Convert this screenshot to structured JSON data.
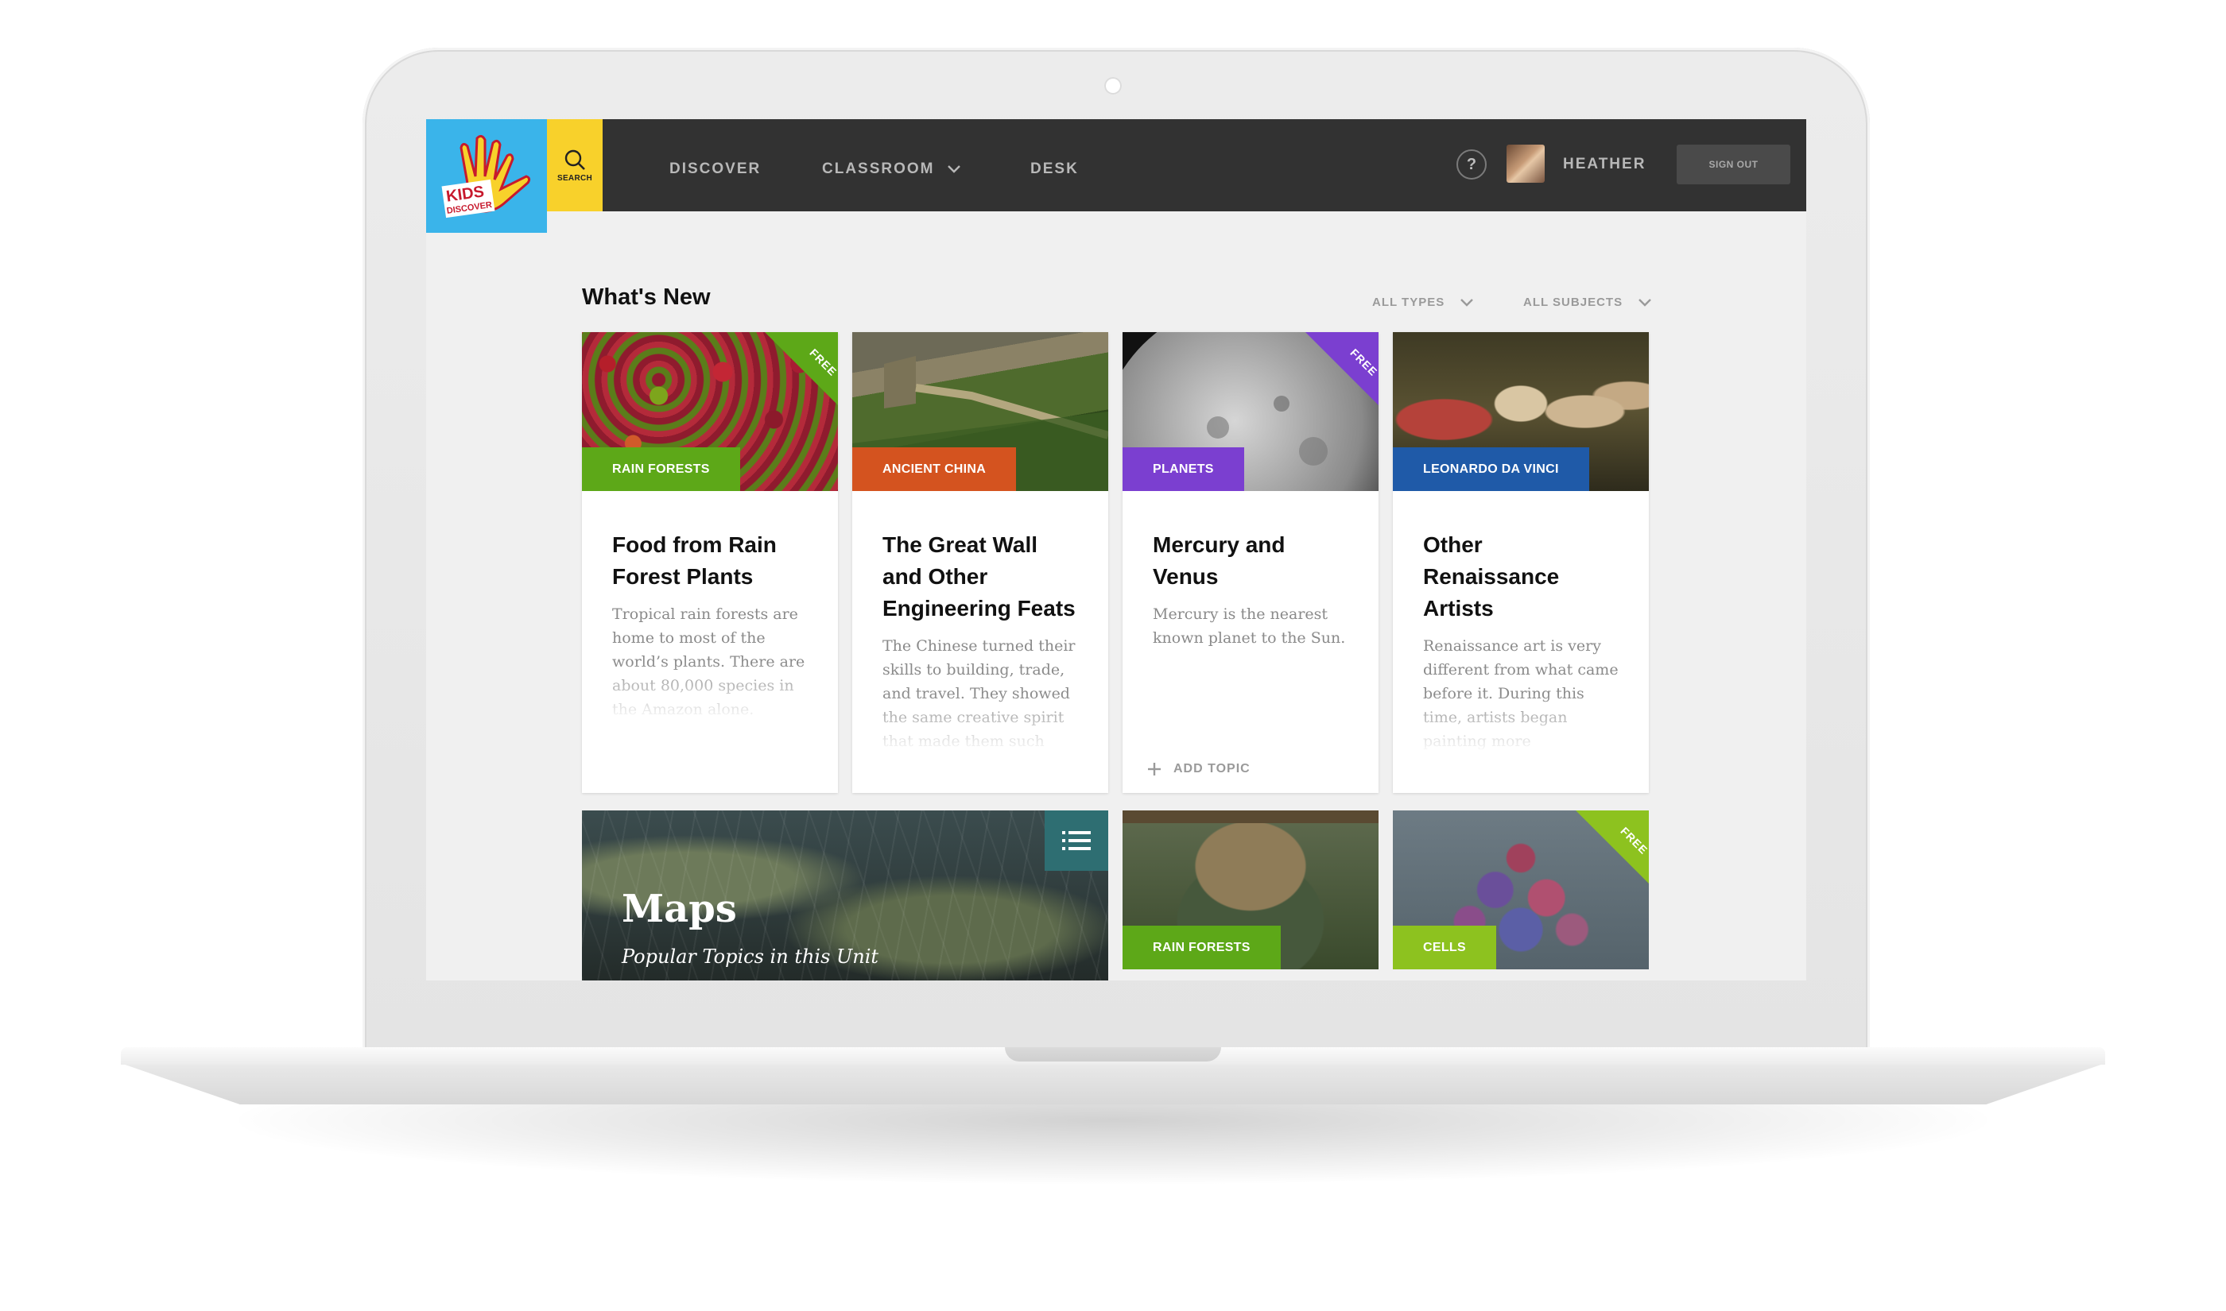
{
  "colors": {
    "topbar": "#323232",
    "logo_bg": "#3ab4ea",
    "search_bg": "#f8d12b",
    "tag_green": "#5da818",
    "tag_orange": "#d4531f",
    "tag_purple": "#7b3fd0",
    "tag_blue": "#1f5aa8",
    "tag_lime": "#8dc21f",
    "free_green": "#5da818",
    "free_purple": "#7b3fd0",
    "free_lime": "#8dc21f"
  },
  "logo": {
    "text": "KIDS DISCOVER"
  },
  "header": {
    "search_label": "SEARCH",
    "nav": [
      "DISCOVER",
      "CLASSROOM",
      "DESK"
    ],
    "help_label": "?",
    "user_name": "HEATHER",
    "signout_label": "SIGN OUT"
  },
  "main": {
    "section_title": "What's New",
    "filter_types": "ALL TYPES",
    "filter_subjects": "ALL SUBJECTS",
    "free_label": "FREE",
    "cards": [
      {
        "tag": "RAIN FORESTS",
        "title": "Food from Rain Forest Plants",
        "description": "Tropical rain forests are home to most of the world’s plants. There are about 80,000 species in the Amazon alone."
      },
      {
        "tag": "ANCIENT CHINA",
        "title": "The Great Wall and Other Engineering Feats",
        "description": "The Chinese turned their skills to building, trade, and travel. They showed the same creative spirit that made them such"
      },
      {
        "tag": "PLANETS",
        "title": "Mercury and Venus",
        "description": "Mercury is the nearest known planet to the Sun.",
        "action": "ADD TOPIC"
      },
      {
        "tag": "LEONARDO DA VINCI",
        "title": "Other Renaissance Artists",
        "description": "Renaissance art is very different from what came before it. During this time, artists began painting more"
      }
    ],
    "unit": {
      "title": "Maps",
      "subtitle": "Popular Topics in this Unit"
    },
    "bottom_cards": [
      {
        "tag": "RAIN FORESTS"
      },
      {
        "tag": "CELLS"
      }
    ]
  }
}
